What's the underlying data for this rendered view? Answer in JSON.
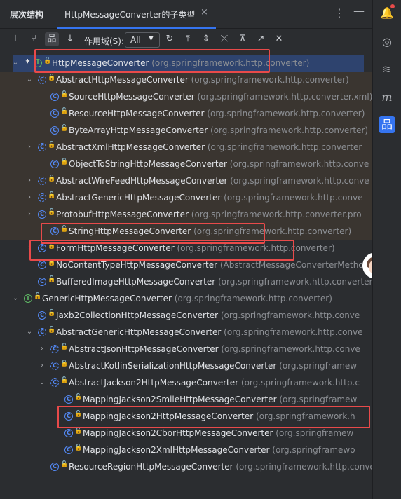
{
  "header": {
    "title": "层次结构",
    "tab_label": "HttpMessageConverter的子类型",
    "close": "×",
    "more": "⋮",
    "minimize": "—"
  },
  "toolbar": {
    "scope_label": "作用域(S):",
    "scope_value": "All",
    "buttons": [
      "subtypes-hierarchy",
      "supertypes-hierarchy",
      "class-hierarchy",
      "sort-alphabetically",
      "refresh",
      "export",
      "expand-all",
      "collapse-all",
      "pin",
      "open-in-window",
      "close"
    ]
  },
  "tree": {
    "rows": [
      {
        "chevron": "expanded",
        "star": "*",
        "icon": "I",
        "kind": "interface",
        "lock": "green",
        "name": "HttpMessageConverter",
        "pkg": "(org.springframework.http.converter)",
        "selected": true
      },
      {
        "chevron": "expanded",
        "icon": "C",
        "kind": "abstract",
        "lock": "green",
        "name": "AbstractHttpMessageConverter",
        "pkg": "(org.springframework.http.converter)"
      },
      {
        "icon": "C",
        "kind": "class",
        "lock": "green",
        "name": "SourceHttpMessageConverter",
        "pkg": "(org.springframework.http.converter.xml)"
      },
      {
        "icon": "C",
        "kind": "class",
        "lock": "green",
        "name": "ResourceHttpMessageConverter",
        "pkg": "(org.springframework.http.converter)"
      },
      {
        "icon": "C",
        "kind": "class",
        "lock": "green",
        "name": "ByteArrayHttpMessageConverter",
        "pkg": "(org.springframework.http.converter)"
      },
      {
        "chevron": "collapsed",
        "icon": "C",
        "kind": "abstract",
        "lock": "green",
        "name": "AbstractXmlHttpMessageConverter",
        "pkg": "(org.springframework.http.converter"
      },
      {
        "icon": "C",
        "kind": "class",
        "lock": "green",
        "name": "ObjectToStringHttpMessageConverter",
        "pkg": "(org.springframework.http.conve"
      },
      {
        "chevron": "collapsed",
        "icon": "C",
        "kind": "abstract",
        "lock": "green",
        "name": "AbstractWireFeedHttpMessageConverter",
        "pkg": "(org.springframework.http.conve"
      },
      {
        "chevron": "collapsed",
        "icon": "C",
        "kind": "abstract",
        "lock": "green",
        "name": "AbstractGenericHttpMessageConverter",
        "pkg": "(org.springframework.http.conve"
      },
      {
        "chevron": "collapsed",
        "icon": "C",
        "kind": "class",
        "lock": "green",
        "name": "ProtobufHttpMessageConverter",
        "pkg": "(org.springframework.http.converter.pro"
      },
      {
        "icon": "C",
        "kind": "class",
        "lock": "green",
        "name": "StringHttpMessageConverter",
        "pkg": "(org.springframework.http.converter)"
      },
      {
        "chevron": "collapsed",
        "icon": "C",
        "kind": "class",
        "lock": "green",
        "name": "FormHttpMessageConverter",
        "pkg": "(org.springframework.http.converter)"
      },
      {
        "icon": "C",
        "kind": "class",
        "lock": "red",
        "name": "NoContentTypeHttpMessageConverter",
        "pkg": "(AbstractMessageConverterMetho"
      },
      {
        "icon": "C",
        "kind": "class",
        "lock": "green",
        "name": "BufferedImageHttpMessageConverter",
        "pkg": "(org.springframework.http.converter)"
      },
      {
        "chevron": "expanded",
        "icon": "I",
        "kind": "interface",
        "lock": "green",
        "name": "GenericHttpMessageConverter",
        "pkg": "(org.springframework.http.converter)"
      },
      {
        "icon": "C",
        "kind": "class",
        "lock": "green",
        "name": "Jaxb2CollectionHttpMessageConverter",
        "pkg": "(org.springframework.http.conve"
      },
      {
        "chevron": "expanded",
        "icon": "C",
        "kind": "abstract",
        "lock": "green",
        "name": "AbstractGenericHttpMessageConverter",
        "pkg": "(org.springframework.http.conve"
      },
      {
        "chevron": "collapsed",
        "icon": "C",
        "kind": "abstract",
        "lock": "green",
        "name": "AbstractJsonHttpMessageConverter",
        "pkg": "(org.springframework.http.conve"
      },
      {
        "chevron": "collapsed",
        "icon": "C",
        "kind": "abstract",
        "lock": "green",
        "name": "AbstractKotlinSerializationHttpMessageConverter",
        "pkg": "(org.springframew"
      },
      {
        "chevron": "expanded",
        "icon": "C",
        "kind": "abstract",
        "lock": "green",
        "name": "AbstractJackson2HttpMessageConverter",
        "pkg": "(org.springframework.http.c"
      },
      {
        "icon": "C",
        "kind": "class",
        "lock": "green",
        "name": "MappingJackson2SmileHttpMessageConverter",
        "pkg": "(org.springframew"
      },
      {
        "icon": "C",
        "kind": "class",
        "lock": "green",
        "name": "MappingJackson2HttpMessageConverter",
        "pkg": "(org.springframework.h"
      },
      {
        "icon": "C",
        "kind": "class",
        "lock": "green",
        "name": "MappingJackson2CborHttpMessageConverter",
        "pkg": "(org.springframew"
      },
      {
        "icon": "C",
        "kind": "class",
        "lock": "green",
        "name": "MappingJackson2XmlHttpMessageConverter",
        "pkg": "(org.springframewo"
      },
      {
        "icon": "C",
        "kind": "class",
        "lock": "green",
        "name": "ResourceRegionHttpMessageConverter",
        "pkg": "(org.springframework.http.converte"
      }
    ]
  },
  "right_bar": {
    "icons": [
      "notifications-icon",
      "ai-assistant-icon",
      "database-icon",
      "maven-icon",
      "hierarchy-icon"
    ]
  },
  "colors": {
    "accent": "#3574f0",
    "selection": "#2e436e",
    "highlight_box": "#e84a4a",
    "class_icon": "#548af7",
    "interface_icon": "#5fb865"
  }
}
